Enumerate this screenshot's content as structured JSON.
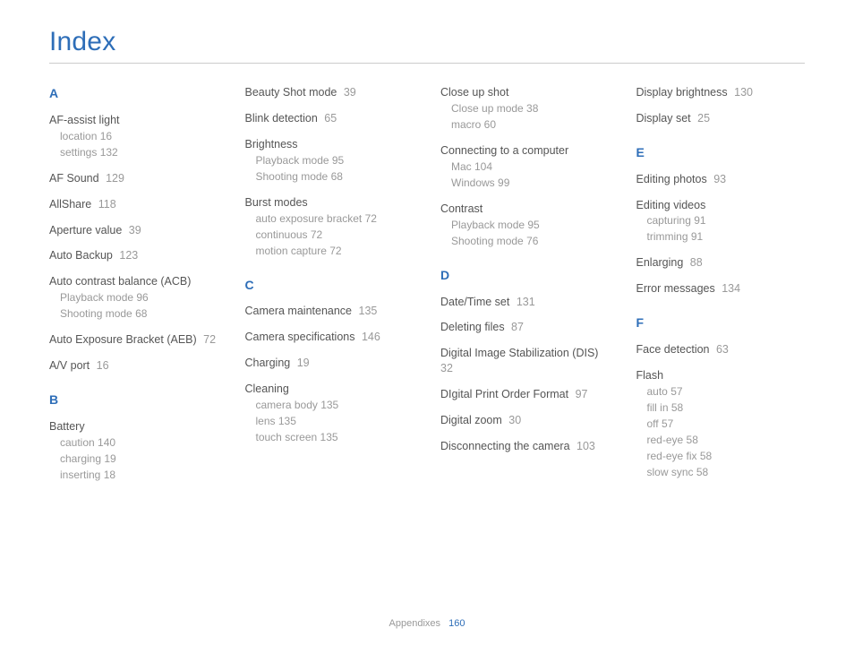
{
  "title": "Index",
  "footer": {
    "section": "Appendixes",
    "page": "160"
  },
  "columns": [
    [
      {
        "type": "letter",
        "text": "A",
        "first": true
      },
      {
        "type": "group",
        "label": "AF-assist light",
        "subs": [
          {
            "label": "location",
            "page": "16"
          },
          {
            "label": "settings",
            "page": "132"
          }
        ]
      },
      {
        "type": "entry",
        "label": "AF Sound",
        "page": "129"
      },
      {
        "type": "entry",
        "label": "AllShare",
        "page": "118"
      },
      {
        "type": "entry",
        "label": "Aperture value",
        "page": "39"
      },
      {
        "type": "entry",
        "label": "Auto Backup",
        "page": "123"
      },
      {
        "type": "group",
        "label": "Auto contrast balance (ACB)",
        "subs": [
          {
            "label": "Playback mode",
            "page": "96"
          },
          {
            "label": "Shooting mode",
            "page": "68"
          }
        ]
      },
      {
        "type": "entry",
        "label": "Auto Exposure Bracket (AEB)",
        "page": "72"
      },
      {
        "type": "entry",
        "label": "A/V port",
        "page": "16"
      },
      {
        "type": "letter",
        "text": "B"
      },
      {
        "type": "group",
        "label": "Battery",
        "subs": [
          {
            "label": "caution",
            "page": "140"
          },
          {
            "label": "charging",
            "page": "19"
          },
          {
            "label": "inserting",
            "page": "18"
          }
        ]
      }
    ],
    [
      {
        "type": "entry",
        "label": "Beauty Shot mode",
        "page": "39",
        "first": true
      },
      {
        "type": "entry",
        "label": "Blink detection",
        "page": "65"
      },
      {
        "type": "group",
        "label": "Brightness",
        "subs": [
          {
            "label": "Playback mode",
            "page": "95"
          },
          {
            "label": "Shooting mode",
            "page": "68"
          }
        ]
      },
      {
        "type": "group",
        "label": "Burst modes",
        "subs": [
          {
            "label": "auto exposure bracket",
            "page": "72"
          },
          {
            "label": "continuous",
            "page": "72"
          },
          {
            "label": "motion capture",
            "page": "72"
          }
        ]
      },
      {
        "type": "letter",
        "text": "C"
      },
      {
        "type": "entry",
        "label": "Camera maintenance",
        "page": "135"
      },
      {
        "type": "entry",
        "label": "Camera specifications",
        "page": "146"
      },
      {
        "type": "entry",
        "label": "Charging",
        "page": "19"
      },
      {
        "type": "group",
        "label": "Cleaning",
        "subs": [
          {
            "label": "camera body",
            "page": "135"
          },
          {
            "label": "lens",
            "page": "135"
          },
          {
            "label": "touch screen",
            "page": "135"
          }
        ]
      }
    ],
    [
      {
        "type": "group",
        "label": "Close up shot",
        "first": true,
        "subs": [
          {
            "label": "Close up mode",
            "page": "38"
          },
          {
            "label": "macro",
            "page": "60"
          }
        ]
      },
      {
        "type": "group",
        "label": "Connecting to a computer",
        "subs": [
          {
            "label": "Mac",
            "page": "104"
          },
          {
            "label": "Windows",
            "page": "99"
          }
        ]
      },
      {
        "type": "group",
        "label": "Contrast",
        "subs": [
          {
            "label": "Playback mode",
            "page": "95"
          },
          {
            "label": "Shooting mode",
            "page": "76"
          }
        ]
      },
      {
        "type": "letter",
        "text": "D"
      },
      {
        "type": "entry",
        "label": "Date/Time set",
        "page": "131"
      },
      {
        "type": "entry",
        "label": "Deleting files",
        "page": "87"
      },
      {
        "type": "entry",
        "label": "Digital Image Stabilization (DIS)",
        "page": "32"
      },
      {
        "type": "entry",
        "label": "DIgital Print Order Format",
        "page": "97"
      },
      {
        "type": "entry",
        "label": "Digital zoom",
        "page": "30"
      },
      {
        "type": "entry",
        "label": "Disconnecting the camera",
        "page": "103"
      }
    ],
    [
      {
        "type": "entry",
        "label": "Display brightness",
        "page": "130",
        "first": true
      },
      {
        "type": "entry",
        "label": "Display set",
        "page": "25"
      },
      {
        "type": "letter",
        "text": "E"
      },
      {
        "type": "entry",
        "label": "Editing photos",
        "page": "93"
      },
      {
        "type": "group",
        "label": "Editing videos",
        "subs": [
          {
            "label": "capturing",
            "page": "91"
          },
          {
            "label": "trimming",
            "page": "91"
          }
        ]
      },
      {
        "type": "entry",
        "label": "Enlarging",
        "page": "88"
      },
      {
        "type": "entry",
        "label": "Error messages",
        "page": "134"
      },
      {
        "type": "letter",
        "text": "F"
      },
      {
        "type": "entry",
        "label": "Face detection",
        "page": "63"
      },
      {
        "type": "group",
        "label": "Flash",
        "subs": [
          {
            "label": "auto",
            "page": "57"
          },
          {
            "label": "fill in",
            "page": "58"
          },
          {
            "label": "off",
            "page": "57"
          },
          {
            "label": "red-eye",
            "page": "58"
          },
          {
            "label": "red-eye fix",
            "page": "58"
          },
          {
            "label": "slow sync",
            "page": "58"
          }
        ]
      }
    ]
  ]
}
